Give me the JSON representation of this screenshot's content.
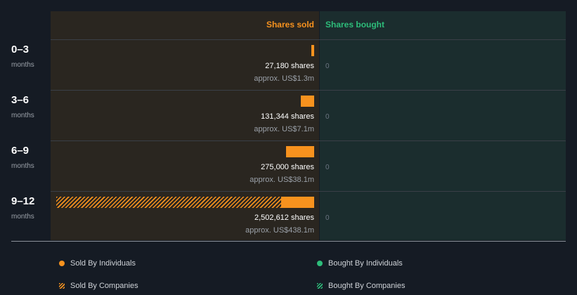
{
  "chart_data": {
    "type": "bar",
    "orientation": "horizontal",
    "columns": {
      "sold": "Shares sold",
      "bought": "Shares bought"
    },
    "rows": [
      {
        "period": "0–3",
        "unit": "months",
        "sold_individuals": 27180,
        "sold_companies": 0,
        "shares_label": "27,180 shares",
        "value_label": "approx. US$1.3m",
        "bought_label": "0"
      },
      {
        "period": "3–6",
        "unit": "months",
        "sold_individuals": 131344,
        "sold_companies": 0,
        "shares_label": "131,344 shares",
        "value_label": "approx. US$7.1m",
        "bought_label": "0"
      },
      {
        "period": "6–9",
        "unit": "months",
        "sold_individuals": 275000,
        "sold_companies": 0,
        "shares_label": "275,000 shares",
        "value_label": "approx. US$38.1m",
        "bought_label": "0"
      },
      {
        "period": "9–12",
        "unit": "months",
        "sold_individuals": 321000,
        "sold_companies": 2181612,
        "shares_label": "2,502,612 shares",
        "value_label": "approx. US$438.1m",
        "bought_label": "0"
      }
    ],
    "xmax": 2502612,
    "legend": [
      {
        "label": "Sold By Individuals",
        "color": "#f7921e",
        "style": "dot"
      },
      {
        "label": "Bought By Individuals",
        "color": "#2dbd7a",
        "style": "dot"
      },
      {
        "label": "Sold By Companies",
        "color": "#f7921e",
        "style": "hatch"
      },
      {
        "label": "Bought By Companies",
        "color": "#2dbd7a",
        "style": "hatch"
      }
    ],
    "colors": {
      "sold": "#f7921e",
      "bought": "#2dbd7a"
    }
  }
}
